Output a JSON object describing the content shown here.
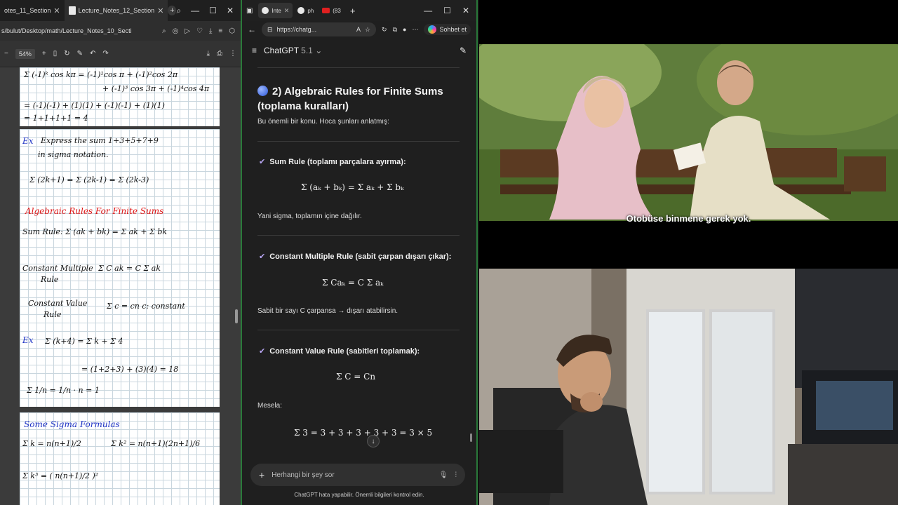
{
  "pdf_viewer": {
    "tabs": [
      {
        "label": "otes_11_Section"
      },
      {
        "label": "Lecture_Notes_12_Section"
      }
    ],
    "address": "s/bulut/Desktop/math/Lecture_Notes_10_Secti",
    "zoom": "54%",
    "notes": {
      "p1": [
        "Σ (-1)ᵏ cos kπ = (-1)¹cos π + (-1)²cos 2π",
        "+ (-1)³ cos 3π + (-1)⁴cos 4π",
        "= (-1)(-1) + (1)(1) + (-1)(-1) + (1)(1)",
        "= 1+1+1+1 = 4"
      ],
      "ex1_label": "Ex",
      "ex1_text": "Express the sum 1+3+5+7+9",
      "ex1_text2": "in sigma notation.",
      "ex1_math": "Σ (2k+1) = Σ (2k-1) = Σ (2k-3)",
      "rules_title": "Algebraic Rules For Finite Sums",
      "sum_rule": "Sum Rule:  Σ (ak + bk) = Σ ak + Σ bk",
      "const_mult_label": "Constant Multiple",
      "const_mult_label2": "Rule",
      "const_mult_math": "Σ C ak = C Σ ak",
      "const_val_label": "Constant Value",
      "const_val_label2": "Rule",
      "const_val_math": "Σ c = cn    c: constant",
      "ex2_label": "Ex",
      "ex2_math": "Σ (k+4) = Σ k + Σ 4",
      "ex2_line2": "= (1+2+3) + (3)(4) = 18",
      "ex2_line3": "Σ 1/n = 1/n · n = 1",
      "formulas_title": "Some Sigma Formulas",
      "formula1": "Σ k = n(n+1)/2",
      "formula2": "Σ k² = n(n+1)(2n+1)/6",
      "formula3": "Σ k³ = ( n(n+1)/2 )²"
    }
  },
  "browser": {
    "tabs": [
      {
        "label": "Inte"
      },
      {
        "label": "ph"
      },
      {
        "label": "(83"
      }
    ],
    "url": "https://chatg...",
    "sohbet": "Sohbet et",
    "gpt_title": "ChatGPT",
    "gpt_version": "5.1",
    "heading": "2) Algebraic Rules for Finite Sums (toplama kuralları)",
    "intro": "Bu önemli bir konu. Hoca şunları anlatmış:",
    "rule1_title": "Sum Rule (toplamı parçalara ayırma):",
    "rule1_math": "Σ (aₖ + bₖ) = Σ aₖ + Σ bₖ",
    "rule1_text": "Yani sigma, toplamın içine dağılır.",
    "rule2_title": "Constant Multiple Rule (sabit çarpan dışarı çıkar):",
    "rule2_math": "Σ Caₖ = C Σ aₖ",
    "rule2_text": "Sabit bir sayı C çarpansa → dışarı atabilirsin.",
    "rule3_title": "Constant Value Rule (sabitleri toplamak):",
    "rule3_math": "Σ C = Cn",
    "mesela": "Mesela:",
    "example_math": "Σ 3 = 3 + 3 + 3 + 3 + 3 = 3 × 5",
    "composer_placeholder": "Herhangi bir şey sor",
    "footer": "ChatGPT hata yapabilir. Önemli bilgileri kontrol edin."
  },
  "movie": {
    "subtitle": "Otobüse binmene gerek yok."
  }
}
